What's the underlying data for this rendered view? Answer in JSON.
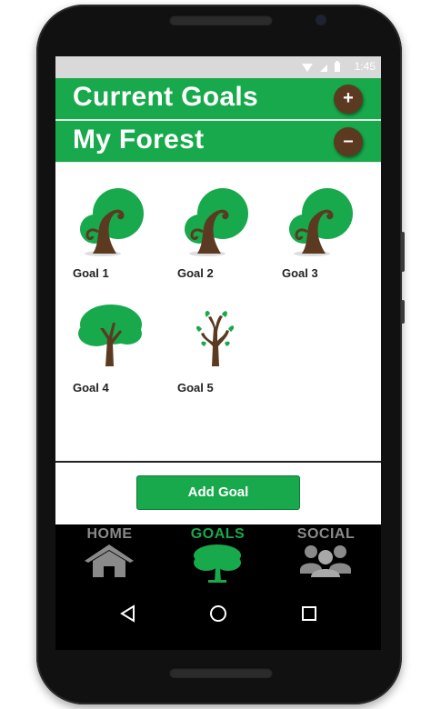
{
  "status_bar": {
    "time": "1:45",
    "icons": [
      "wifi-icon",
      "signal-icon",
      "battery-icon"
    ]
  },
  "sections": [
    {
      "title": "Current Goals",
      "button": "+"
    },
    {
      "title": "My Forest",
      "button": "–"
    }
  ],
  "goals": [
    {
      "label": "Goal 1",
      "icon": "curly-tree-icon"
    },
    {
      "label": "Goal 2",
      "icon": "curly-tree-icon"
    },
    {
      "label": "Goal 3",
      "icon": "curly-tree-icon"
    },
    {
      "label": "Goal 4",
      "icon": "round-tree-icon"
    },
    {
      "label": "Goal 5",
      "icon": "sapling-icon"
    }
  ],
  "add_button": "Add Goal",
  "bottom_nav": [
    {
      "label": "HOME",
      "icon": "home-icon",
      "active": false
    },
    {
      "label": "GOALS",
      "icon": "tree-icon",
      "active": true
    },
    {
      "label": "SOCIAL",
      "icon": "group-icon",
      "active": false
    }
  ],
  "system_nav": [
    "back-icon",
    "home-circle-icon",
    "recents-icon"
  ],
  "colors": {
    "accent": "#17a94b",
    "button_brown": "#5b3a21",
    "nav_inactive": "#8a8a8a",
    "trunk": "#5b3a21"
  }
}
